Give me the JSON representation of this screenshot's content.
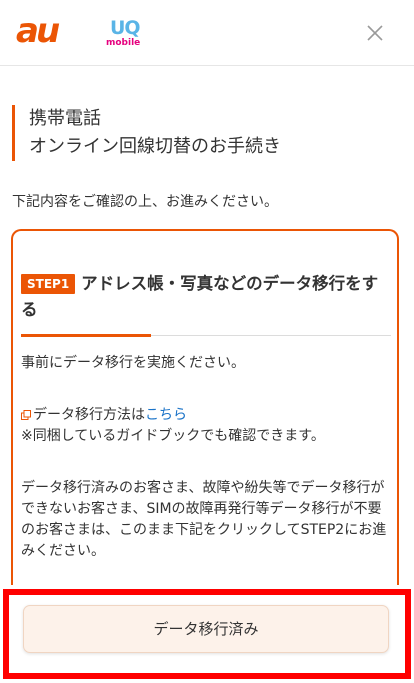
{
  "header": {
    "logo_au": "au",
    "logo_uq": "UQ",
    "logo_uq_sub": "mobile",
    "close_icon": "close-icon",
    "brand_color": "#eb5505"
  },
  "page": {
    "title_line1": "携帯電話",
    "title_line2": "オンライン回線切替のお手続き",
    "intro": "下記内容をご確認の上、お進みください。"
  },
  "step": {
    "badge": "STEP1",
    "title": "アドレス帳・写真などのデータ移行をする",
    "para1": "事前にデータ移行を実施ください。",
    "link_prefix": "データ移行方法は",
    "link_text": "こちら",
    "link_note": "※同梱しているガイドブックでも確認できます。",
    "para3": "データ移行済みのお客さま、故障や紛失等でデータ移行ができないお客さま、SIMの故障再発行等データ移行が不要のお客さまは、このまま下記をクリックしてSTEP2にお進みください。"
  },
  "footer": {
    "button_label": "データ移行済み"
  }
}
